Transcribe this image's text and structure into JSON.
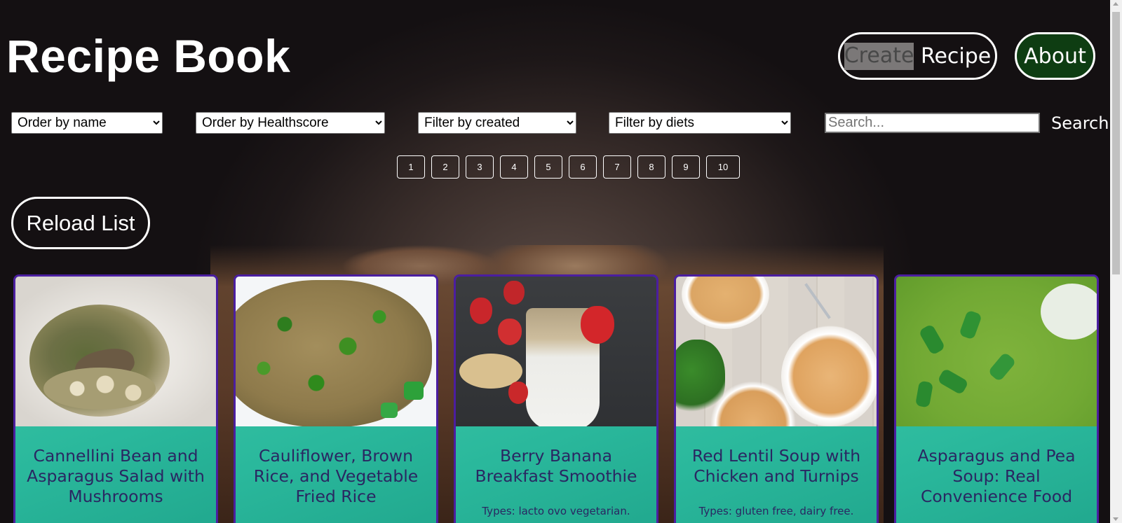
{
  "header": {
    "title": "Recipe Book",
    "create_label_highlighted": "Create",
    "create_label_rest": " Recipe",
    "about_label": "About"
  },
  "filters": {
    "order_name": "Order by name",
    "order_health": "Order by Healthscore",
    "filter_created": "Filter by created",
    "filter_diets": "Filter by diets",
    "search_placeholder": "Search...",
    "search_label": "Search"
  },
  "pagination": [
    "1",
    "2",
    "3",
    "4",
    "5",
    "6",
    "7",
    "8",
    "9",
    "10"
  ],
  "reload_label": "Reload List",
  "cards": [
    {
      "title": "Cannellini Bean and Asparagus Salad with Mushrooms",
      "types": ""
    },
    {
      "title": "Cauliflower, Brown Rice, and Vegetable Fried Rice",
      "types": ""
    },
    {
      "title": "Berry Banana Breakfast Smoothie",
      "types": "Types: lacto ovo vegetarian."
    },
    {
      "title": "Red Lentil Soup with Chicken and Turnips",
      "types": "Types: gluten free, dairy free."
    },
    {
      "title": "Asparagus and Pea Soup: Real Convenience Food",
      "types": ""
    }
  ],
  "colors": {
    "card_border": "#4b1ea0",
    "card_background": "#2ab89c",
    "card_text": "#2a2762",
    "about_background": "#0e3d12"
  }
}
